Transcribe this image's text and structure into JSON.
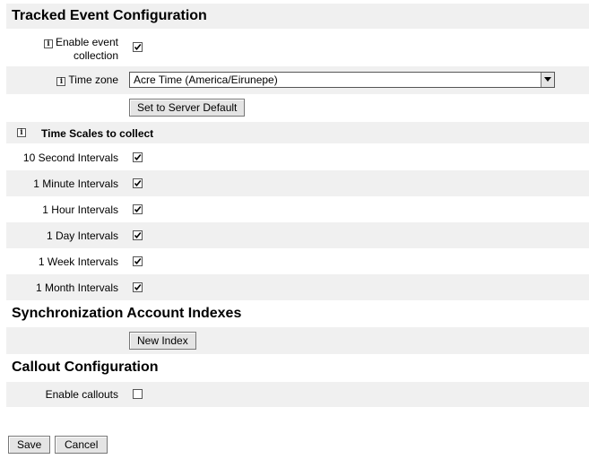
{
  "tracked": {
    "title": "Tracked Event Configuration",
    "enable_label_line1": "Enable event",
    "enable_label_line2": "collection",
    "enable_checked": true,
    "timezone_label": "Time zone",
    "timezone_value": "Acre Time (America/Eirunepe)",
    "server_default_button": "Set to Server Default"
  },
  "time_scales": {
    "heading": "Time Scales to collect",
    "items": [
      {
        "label": "10 Second Intervals",
        "checked": true
      },
      {
        "label": "1 Minute Intervals",
        "checked": true
      },
      {
        "label": "1 Hour Intervals",
        "checked": true
      },
      {
        "label": "1 Day Intervals",
        "checked": true
      },
      {
        "label": "1 Week Intervals",
        "checked": true
      },
      {
        "label": "1 Month Intervals",
        "checked": true
      }
    ]
  },
  "sync": {
    "title": "Synchronization Account Indexes",
    "new_index_button": "New Index"
  },
  "callout": {
    "title": "Callout Configuration",
    "enable_label": "Enable callouts",
    "enable_checked": false
  },
  "footer": {
    "save_button": "Save",
    "cancel_button": "Cancel"
  },
  "icons": {
    "info": "info-icon",
    "check": "check-mark-icon",
    "dropdown": "chevron-down-icon"
  },
  "colors": {
    "shaded_row": "#f0f0f0",
    "button_bg": "#e4e4e4"
  }
}
